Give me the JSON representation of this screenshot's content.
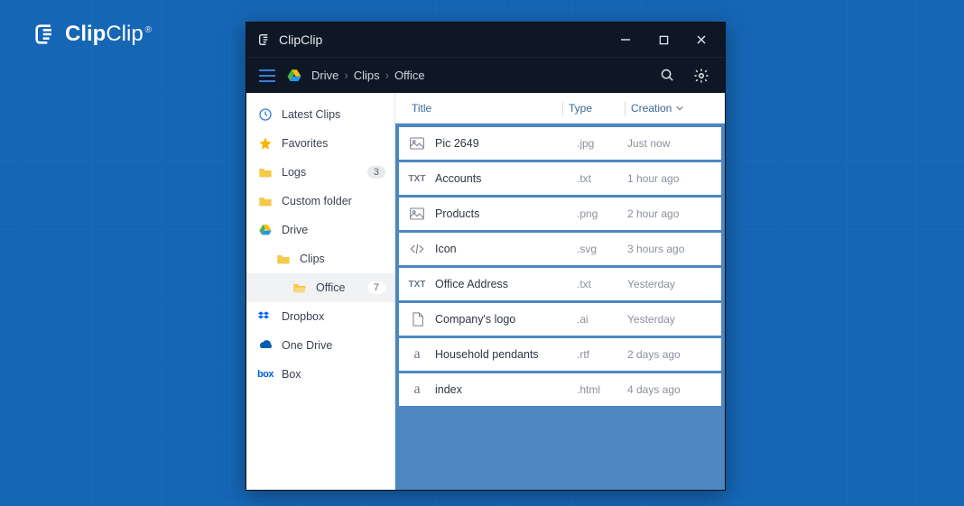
{
  "pageLogo": {
    "bold": "Clip",
    "light": "Clip",
    "reg": "®"
  },
  "window": {
    "title": "ClipClip"
  },
  "breadcrumbs": [
    "Drive",
    "Clips",
    "Office"
  ],
  "columns": {
    "title": "Title",
    "type": "Type",
    "creation": "Creation"
  },
  "sidebar": [
    {
      "label": "Latest Clips"
    },
    {
      "label": "Favorites"
    },
    {
      "label": "Logs",
      "badge": "3"
    },
    {
      "label": "Custom folder"
    },
    {
      "label": "Drive"
    },
    {
      "label": "Clips"
    },
    {
      "label": "Office",
      "badge": "7",
      "selected": true
    },
    {
      "label": "Dropbox"
    },
    {
      "label": "One Drive"
    },
    {
      "label": "Box"
    }
  ],
  "files": [
    {
      "title": "Pic 2649",
      "type": ".jpg",
      "date": "Just now"
    },
    {
      "title": "Accounts",
      "type": ".txt",
      "date": "1 hour ago"
    },
    {
      "title": "Products",
      "type": ".png",
      "date": "2 hour ago"
    },
    {
      "title": "Icon",
      "type": ".svg",
      "date": "3 hours ago"
    },
    {
      "title": "Office Address",
      "type": ".txt",
      "date": "Yesterday"
    },
    {
      "title": "Company's logo",
      "type": ".ai",
      "date": "Yesterday"
    },
    {
      "title": "Household pendants",
      "type": ".rtf",
      "date": "2 days ago"
    },
    {
      "title": "index",
      "type": ".html",
      "date": "4 days ago"
    }
  ]
}
